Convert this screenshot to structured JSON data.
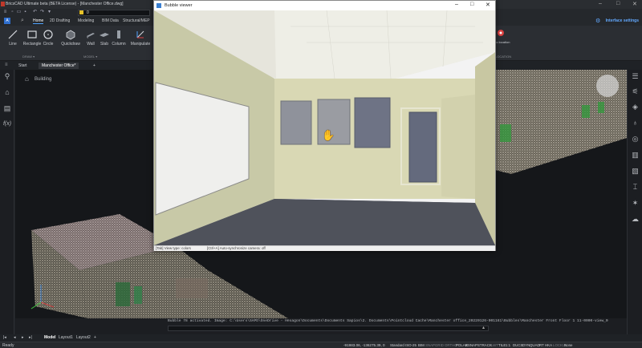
{
  "app": {
    "title": "BricsCAD Ultimate beta (BETA License) - [Manchester Office.dwg]",
    "window_controls": [
      "–",
      "□",
      "✕"
    ],
    "layer_value": "0"
  },
  "ribbon": {
    "tabs": [
      "Home",
      "2D Drafting",
      "Modeling",
      "BIM Data",
      "Structural/MEP"
    ],
    "active_tab": "Home",
    "interface_settings": "Interface settings",
    "tools": [
      {
        "label": "Line",
        "icon": "line-icon"
      },
      {
        "label": "Rectangle",
        "icon": "rectangle-icon"
      },
      {
        "label": "Circle",
        "icon": "circle-icon"
      },
      {
        "label": "Quickdraw",
        "icon": "quickdraw-icon"
      },
      {
        "label": "Wall",
        "icon": "wall-icon"
      },
      {
        "label": "Slab",
        "icon": "slab-icon"
      },
      {
        "label": "Column",
        "icon": "column-icon"
      },
      {
        "label": "Manipulate",
        "icon": "manipulate-icon"
      }
    ],
    "groups": [
      "DRAW ▾",
      "MODEL ▾"
    ],
    "right_tool_label": "Geo location",
    "right_group": "LOCATION"
  },
  "doc_tabs": [
    "Start",
    "Manchester Office*",
    "+"
  ],
  "viewport": {
    "breadcrumb": "Building"
  },
  "bubble_viewer": {
    "title": "Bubble viewer",
    "status_left": "[Tab] View type: colors",
    "status_right": "[Ctrl+A] Auto-synchronize camera: off"
  },
  "command_line": {
    "history": "Bubble 78 activated. Image: C:\\Users\\SAPD\\OneDrive - Hexagon\\Documents\\Documents Sapios\\2. Documents\\Pointcloud Cache\\Manchester office_20220126-001161\\Bubbles\\Manchester Front Floor 1 11-0000-view_0",
    "input": ""
  },
  "layout_tabs": [
    "Model",
    "Layout1",
    "Layout2",
    "+"
  ],
  "status": {
    "ready": "Ready",
    "coords": "-91983.06, -136275.39, 0",
    "buttons": [
      "Standard",
      "ISO-25",
      "BIM",
      "SNAP",
      "GRID",
      "ORTHO",
      "POLAR",
      "ESNAP",
      "STRACK",
      "LWT",
      "TILE",
      "1:1",
      "DUCS",
      "DYN",
      "QUAD",
      "RT",
      "HKA",
      "LOCKUI",
      "None"
    ],
    "off_buttons": [
      "SNAP",
      "GRID",
      "ORTHO",
      "LWT",
      "LOCKUI"
    ]
  },
  "colors": {
    "accent": "#4fa3ff",
    "link": "#63a9ff"
  }
}
